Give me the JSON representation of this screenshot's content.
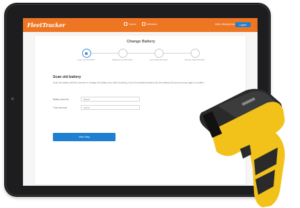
{
  "app": {
    "logo_text": "FleetTracker",
    "nav": [
      {
        "label": "Home",
        "icon": "home-icon"
      },
      {
        "label": "Vehicles",
        "icon": "truck-icon"
      }
    ],
    "user_label": "Hello, MonkeyUser",
    "logout_label": "Logout"
  },
  "page": {
    "title": "Change Battery",
    "steps": [
      {
        "label": "SCAN OLD BATTERY",
        "active": true
      },
      {
        "label": "REMOVE OLD BATTERY",
        "active": false
      },
      {
        "label": "SCAN NEW BATTERY",
        "active": false
      },
      {
        "label": "INSTALL NEW BATTERY",
        "active": false
      }
    ],
    "section_title": "Scan old battery",
    "instructions": "Scan the battery with the scanner to change the battery now. After scanning, move the depleted battery into the battery tell area and scan again to confirm.",
    "fields": [
      {
        "label": "Battery barcode",
        "value": "BH021"
      },
      {
        "label": "Truck barcode",
        "value": "FA079"
      }
    ],
    "primary_button": "Next Step"
  },
  "colors": {
    "header": "#ee7623",
    "accent": "#1f7fd1",
    "scanner_body": "#f2c21a",
    "scanner_dark": "#2a2a2a"
  }
}
